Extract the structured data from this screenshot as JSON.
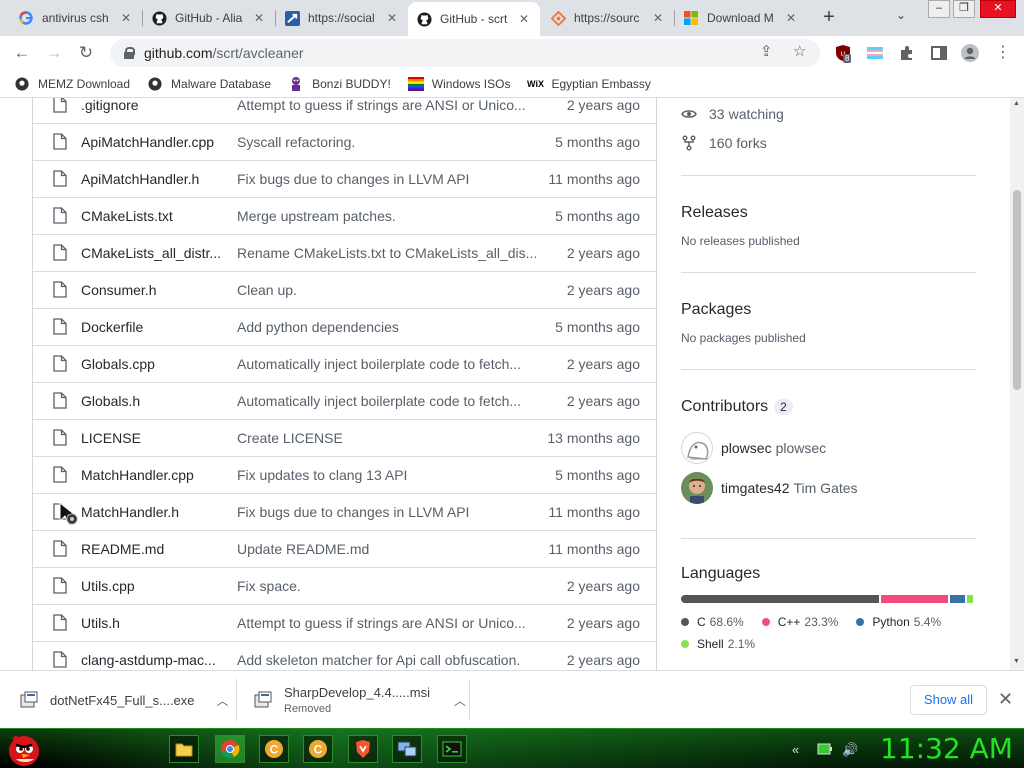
{
  "browser": {
    "tabs": [
      {
        "title": "antivirus csh",
        "icon": "google-icon"
      },
      {
        "title": "GitHub - Alia",
        "icon": "github-icon"
      },
      {
        "title": "https://social",
        "icon": "arrow-icon"
      },
      {
        "title": "GitHub - scrt",
        "icon": "github-icon",
        "active": true
      },
      {
        "title": "https://sourc",
        "icon": "sourcegraph-icon"
      },
      {
        "title": "Download M",
        "icon": "microsoft-icon"
      }
    ],
    "new_tab_label": "+",
    "url_host": "github.com",
    "url_path": "/scrt/avcleaner",
    "extension_badge": "8",
    "bookmarks": [
      {
        "label": "MEMZ Download",
        "icon": "github-icon"
      },
      {
        "label": "Malware Database",
        "icon": "github-icon"
      },
      {
        "label": "Bonzi BUDDY!",
        "icon": "bonzi-icon"
      },
      {
        "label": "Windows ISOs",
        "icon": "rainbow-icon"
      },
      {
        "label": "Egyptian Embassy",
        "icon": "wix-icon"
      }
    ]
  },
  "files": [
    {
      "name": ".gitignore",
      "message": "Attempt to guess if strings are ANSI or Unico...",
      "date": "2 years ago"
    },
    {
      "name": "ApiMatchHandler.cpp",
      "message": "Syscall refactoring.",
      "date": "5 months ago"
    },
    {
      "name": "ApiMatchHandler.h",
      "message": "Fix bugs due to changes in LLVM API",
      "date": "11 months ago"
    },
    {
      "name": "CMakeLists.txt",
      "message": "Merge upstream patches.",
      "date": "5 months ago"
    },
    {
      "name": "CMakeLists_all_distr...",
      "message": "Rename CMakeLists.txt to CMakeLists_all_dis...",
      "date": "2 years ago"
    },
    {
      "name": "Consumer.h",
      "message": "Clean up.",
      "date": "2 years ago"
    },
    {
      "name": "Dockerfile",
      "message": "Add python dependencies",
      "date": "5 months ago"
    },
    {
      "name": "Globals.cpp",
      "message": "Automatically inject boilerplate code to fetch...",
      "date": "2 years ago"
    },
    {
      "name": "Globals.h",
      "message": "Automatically inject boilerplate code to fetch...",
      "date": "2 years ago"
    },
    {
      "name": "LICENSE",
      "message": "Create LICENSE",
      "date": "13 months ago"
    },
    {
      "name": "MatchHandler.cpp",
      "message": "Fix updates to clang 13 API",
      "date": "5 months ago"
    },
    {
      "name": "MatchHandler.h",
      "message": "Fix bugs due to changes in LLVM API",
      "date": "11 months ago"
    },
    {
      "name": "README.md",
      "message": "Update README.md",
      "date": "11 months ago"
    },
    {
      "name": "Utils.cpp",
      "message": "Fix space.",
      "date": "2 years ago"
    },
    {
      "name": "Utils.h",
      "message": "Attempt to guess if strings are ANSI or Unico...",
      "date": "2 years ago"
    },
    {
      "name": "clang-astdump-mac...",
      "message": "Add skeleton matcher for Api call obfuscation.",
      "date": "2 years ago"
    }
  ],
  "sidebar": {
    "watching_count": "33",
    "watching_label": "watching",
    "forks_count": "160",
    "forks_label": "forks",
    "releases_title": "Releases",
    "releases_sub": "No releases published",
    "packages_title": "Packages",
    "packages_sub": "No packages published",
    "contributors_title": "Contributors",
    "contributors_count": "2",
    "contributors": [
      {
        "login": "plowsec",
        "name": "plowsec"
      },
      {
        "login": "timgates42",
        "name": "Tim Gates"
      }
    ],
    "languages_title": "Languages",
    "languages": [
      {
        "name": "C",
        "percent": "68.6%",
        "value": 68.6,
        "color": "#555555"
      },
      {
        "name": "C++",
        "percent": "23.3%",
        "value": 23.3,
        "color": "#f34b7d"
      },
      {
        "name": "Python",
        "percent": "5.4%",
        "value": 5.4,
        "color": "#3572A5"
      },
      {
        "name": "Shell",
        "percent": "2.1%",
        "value": 2.1,
        "color": "#89e051"
      }
    ]
  },
  "downloads": [
    {
      "name": "dotNetFx45_Full_s....exe",
      "status": ""
    },
    {
      "name": "SharpDevelop_4.4.....msi",
      "status": "Removed"
    }
  ],
  "show_all_label": "Show all",
  "taskbar": {
    "clock": "11:32 AM"
  }
}
